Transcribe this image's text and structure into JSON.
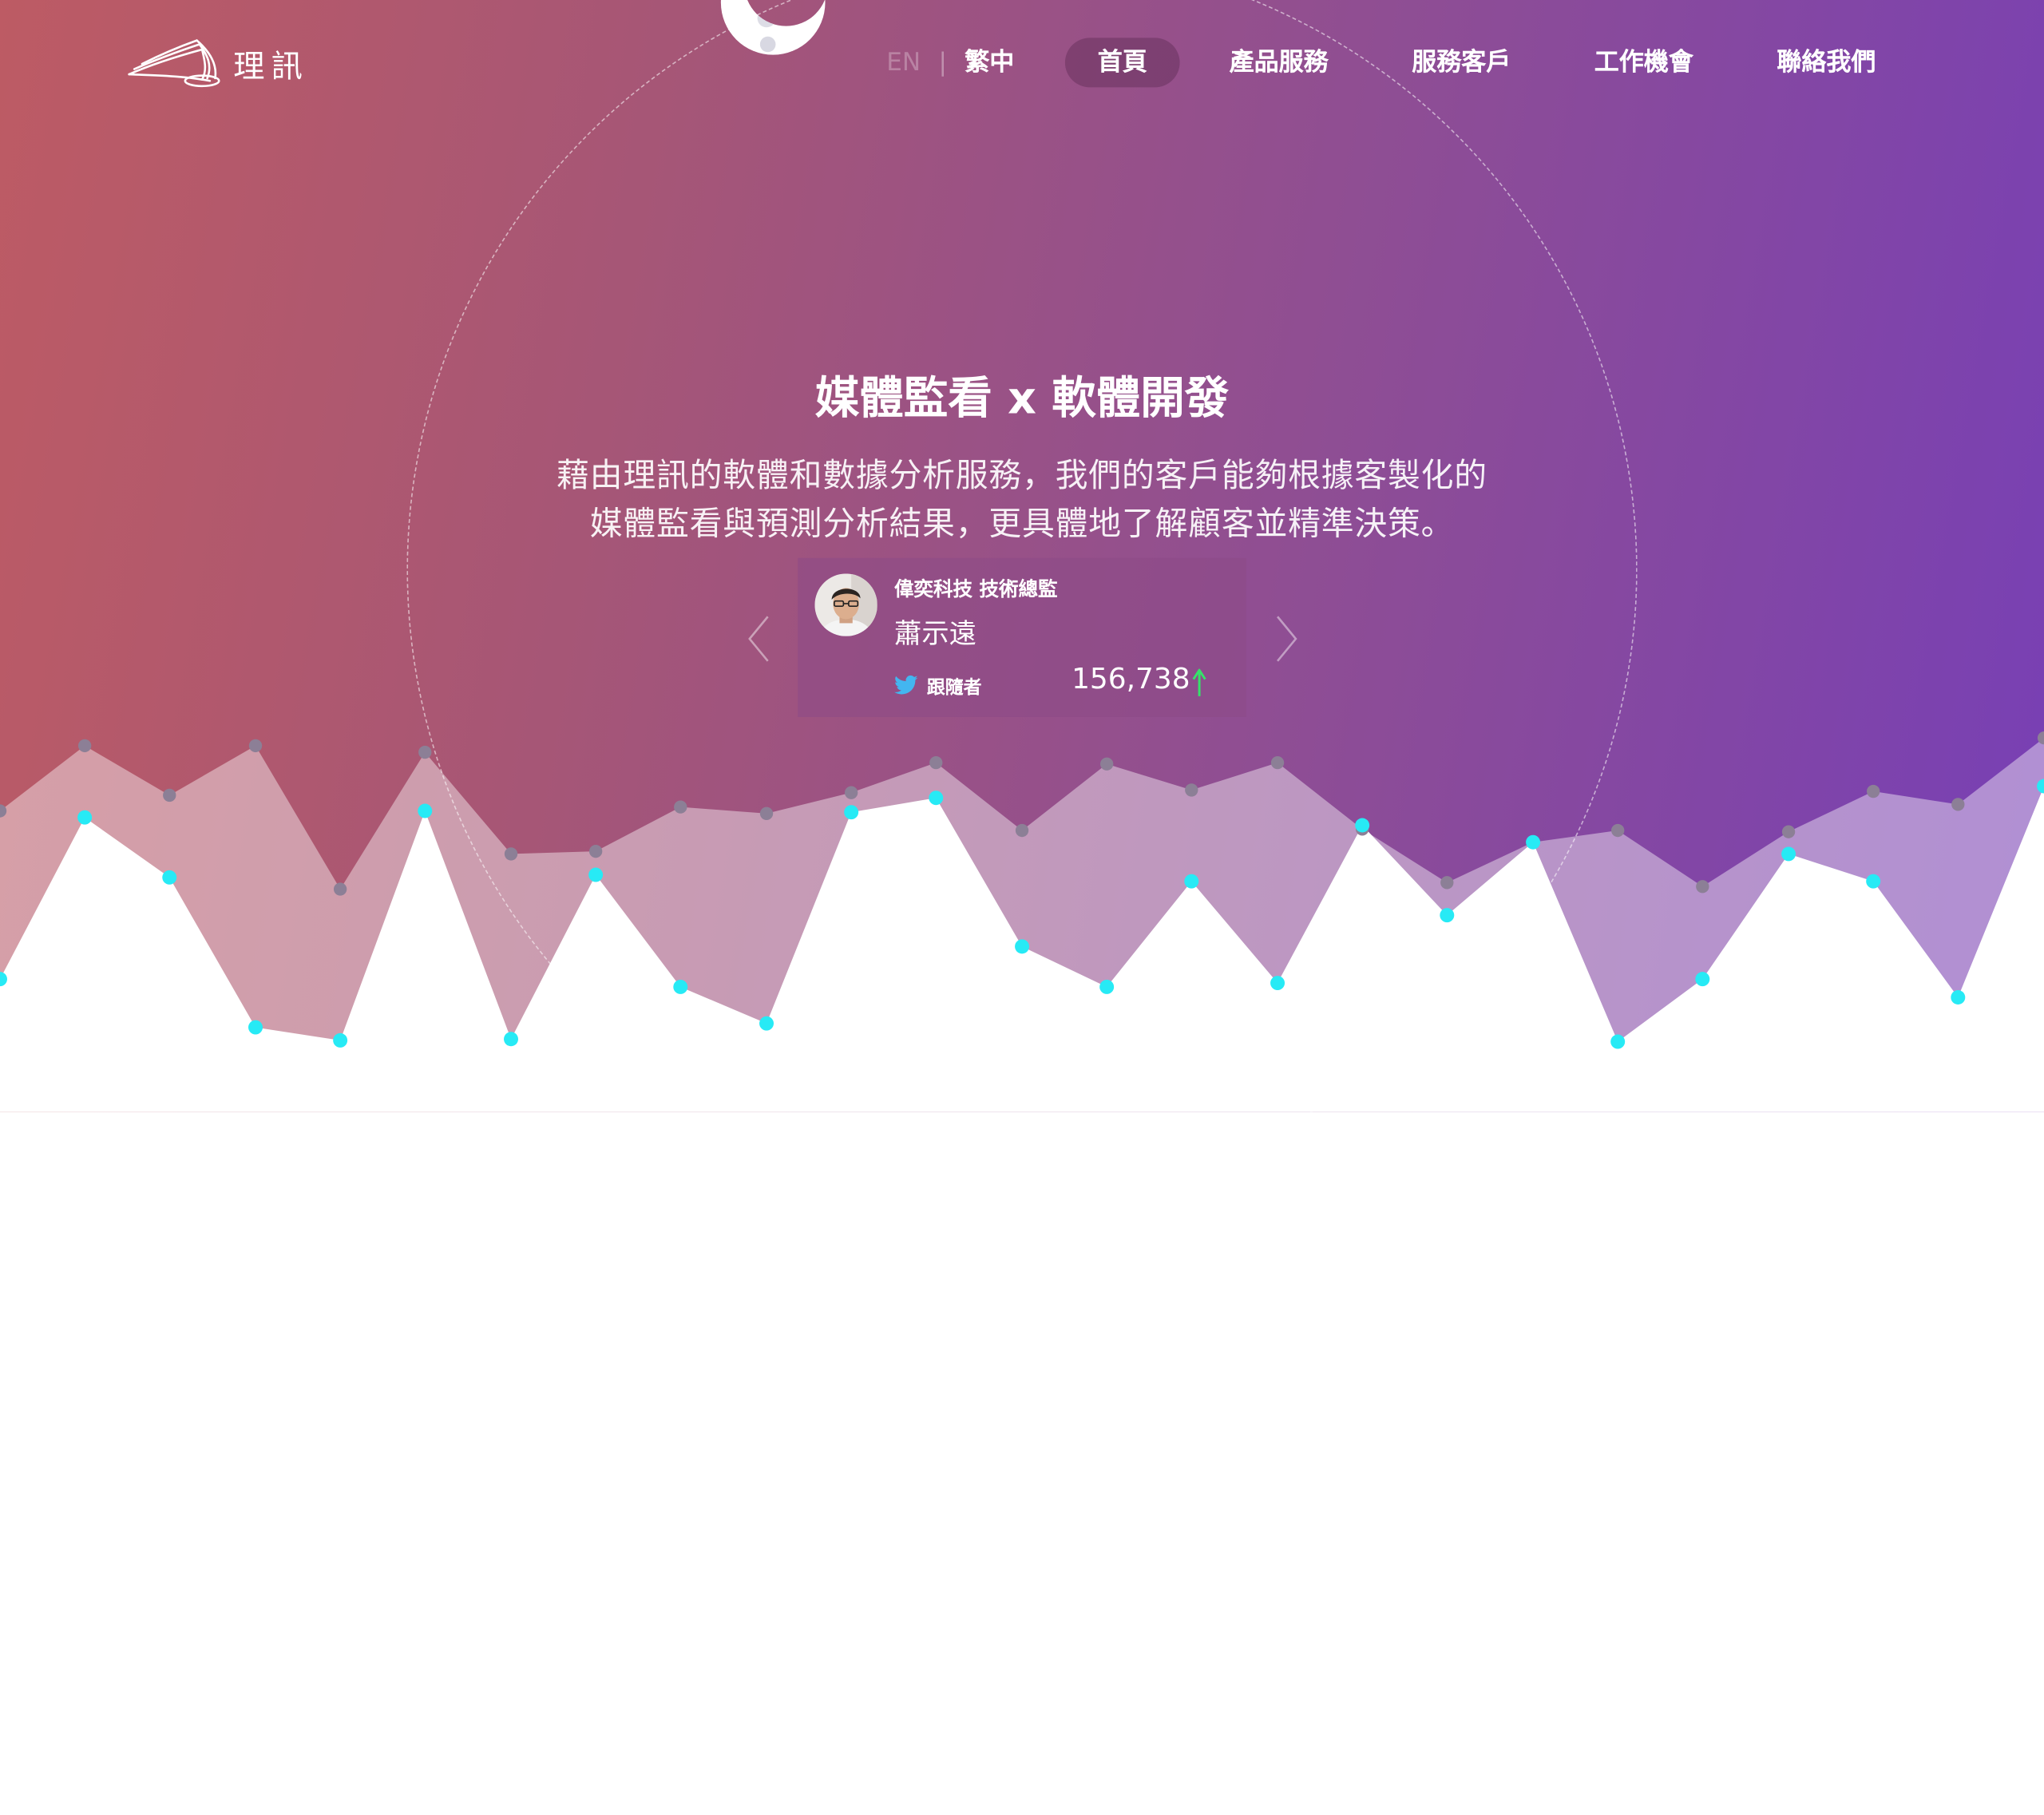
{
  "brand": {
    "logo_text": "理訊"
  },
  "nav": {
    "lang_en": "EN",
    "lang_separator": "|",
    "lang_tw": "繁中",
    "items": [
      {
        "label": "首頁",
        "active": true
      },
      {
        "label": "產品服務",
        "active": false
      },
      {
        "label": "服務客戶",
        "active": false
      },
      {
        "label": "工作機會",
        "active": false
      },
      {
        "label": "聯絡我們",
        "active": false
      }
    ]
  },
  "hero": {
    "headline": "媒體監看 x 軟體開發",
    "subline_1": "藉由理訊的軟體和數據分析服務，我們的客戶能夠根據客製化的",
    "subline_2": "媒體監看與預測分析結果，更具體地了解顧客並精準決策。"
  },
  "testimonial": {
    "company": "偉奕科技 技術總監",
    "name": "蕭示遠",
    "followers_label": "跟隨者",
    "followers_value": "156,738",
    "trend": "up"
  },
  "colors": {
    "gradient_start": "#bd5b64",
    "gradient_end": "#773fb6",
    "marker_front": "#27eaf5",
    "marker_back": "#8c7f96",
    "trend_up": "#35e36a"
  },
  "icons": {
    "logo": "swoosh-logo-icon",
    "moon": "moon-icon",
    "avatar": "person-avatar",
    "twitter": "twitter-bird-icon",
    "trend": "arrow-up-icon",
    "prev": "chevron-left-icon",
    "next": "chevron-right-icon"
  }
}
